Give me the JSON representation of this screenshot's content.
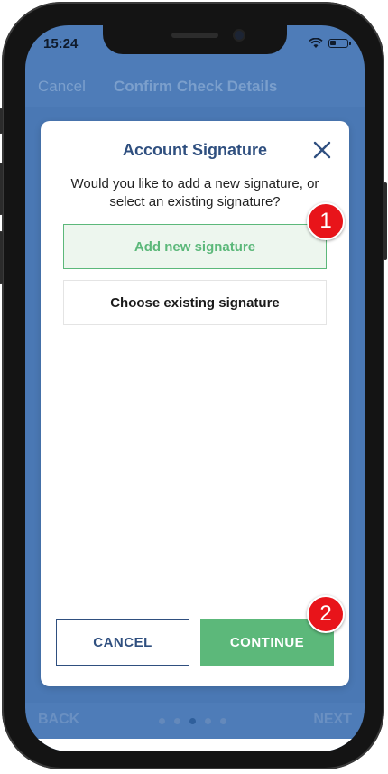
{
  "status": {
    "time": "15:24"
  },
  "nav": {
    "cancel_label": "Cancel",
    "title": "Confirm Check Details"
  },
  "bottom": {
    "back_label": "BACK",
    "next_label": "NEXT"
  },
  "modal": {
    "title": "Account Signature",
    "message": "Would you like to add a new signature, or select an existing signature?",
    "options": {
      "add_new": "Add new signature",
      "choose_existing": "Choose existing signature"
    },
    "cancel_label": "CANCEL",
    "continue_label": "CONTINUE"
  },
  "annotations": {
    "step1": "1",
    "step2": "2"
  },
  "colors": {
    "accent_green": "#5cb87a",
    "primary_blue": "#2f4f7f",
    "badge_red": "#e8141a"
  },
  "icons": {
    "close": "close-icon",
    "wifi": "wifi-icon",
    "battery": "battery-icon"
  }
}
